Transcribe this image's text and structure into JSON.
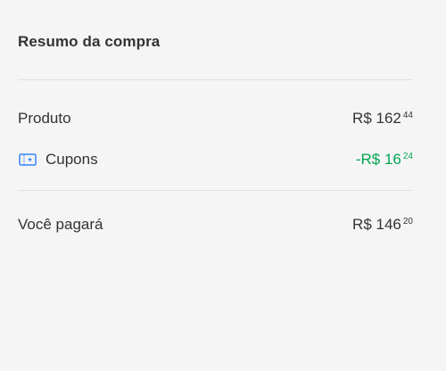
{
  "summary": {
    "title": "Resumo da compra"
  },
  "rows": {
    "produto": {
      "label": "Produto",
      "amount": "R$ 162",
      "cents": "44"
    },
    "cupons": {
      "icon": "coupon-ticket-icon",
      "label": "Cupons",
      "amount": "-R$ 16",
      "cents": "24"
    },
    "total": {
      "label": "Você pagará",
      "amount": "R$ 146",
      "cents": "20"
    }
  },
  "colors": {
    "background": "#f5f5f5",
    "text": "#333333",
    "discount": "#00a650",
    "coupon_icon": "#3483fa",
    "divider": "#e0e0e0"
  }
}
